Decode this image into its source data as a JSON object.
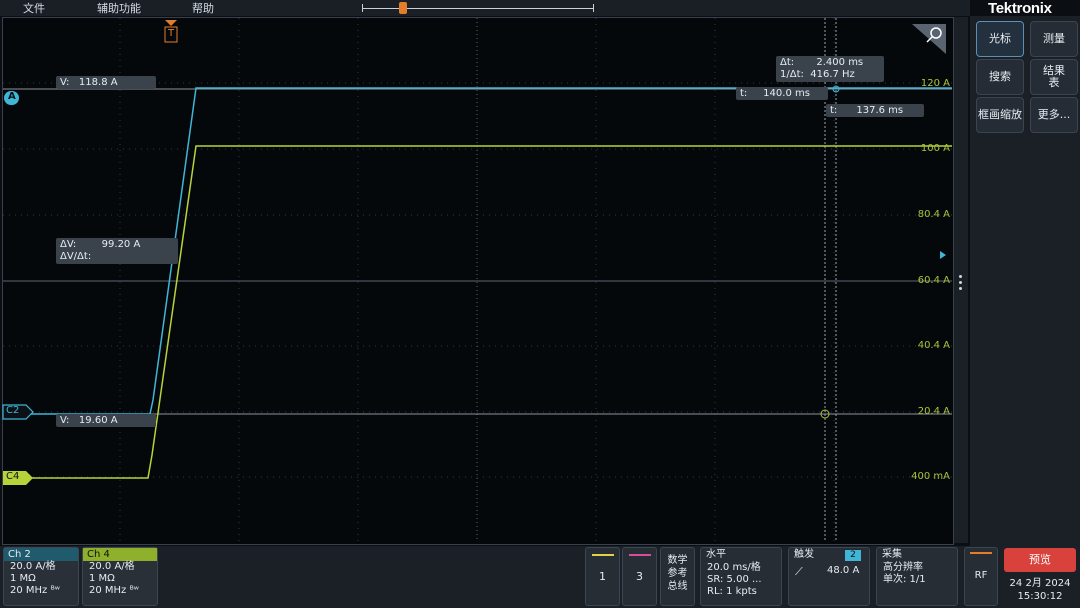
{
  "menu": [
    "文件",
    "辅助功能",
    "帮助"
  ],
  "brand": "Tektronix",
  "right_panel": {
    "buttons": [
      "光标",
      "测量",
      "搜索",
      "结果\n表",
      "框画缩放",
      "更多..."
    ]
  },
  "readouts": {
    "v_top": "V:   118.8 A",
    "v_bottom": "V:   19.60 A",
    "delta_v": "ΔV:        99.20 A",
    "delta_v_dt": "ΔV/Δt:",
    "delta_t": "Δt:       2.400 ms",
    "inv_delta_t": "1/Δt:  416.7 Hz",
    "t1": "t:     140.0 ms",
    "t2": "t:      137.6 ms"
  },
  "scale_labels": [
    "120 A",
    "100 A",
    "80.4 A",
    "60.4 A",
    "40.4 A",
    "20.4 A",
    "400 mA"
  ],
  "markers": {
    "cursor_a": "A",
    "ch2": "C2",
    "ch4": "C4",
    "trigger": "T"
  },
  "colors": {
    "ch2": "#3fb6d6",
    "ch4": "#b6d43a",
    "trigger": "#e27d2b",
    "accent": "#d9423c"
  },
  "channels": [
    {
      "name": "Ch 2",
      "scale": "20.0 A/格",
      "impedance": "1 MΩ",
      "bandwidth": "20 MHz ᴮʷ"
    },
    {
      "name": "Ch 4",
      "scale": "20.0 A/格",
      "impedance": "1 MΩ",
      "bandwidth": "20 MHz ᴮʷ"
    }
  ],
  "bottom": {
    "slot1": "1",
    "slot3": "3",
    "ref_bus": [
      "数学",
      "参考",
      "总线"
    ],
    "horizontal": {
      "title": "水平",
      "lines": [
        "20.0 ms/格",
        "SR: 5.00 ...",
        "RL: 1 kpts"
      ]
    },
    "trigger": {
      "title": "触发",
      "badge": "2",
      "level": "48.0 A"
    },
    "acquire": {
      "title": "采集",
      "lines": [
        "高分辨率",
        "单次: 1/1"
      ]
    },
    "rf": "RF",
    "preview": "预览",
    "date": "24 2月 2024",
    "time": "15:30:12"
  }
}
